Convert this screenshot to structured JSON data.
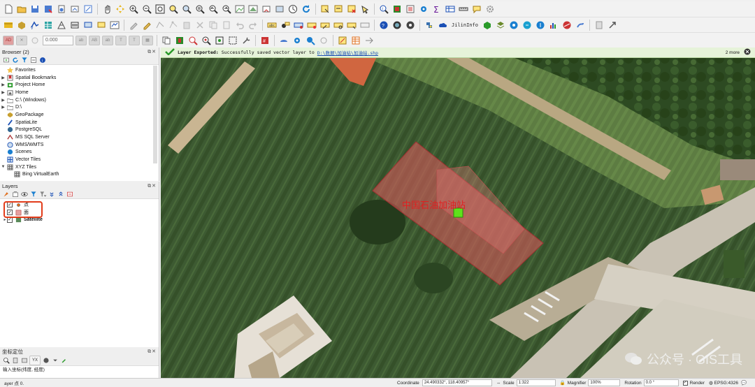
{
  "browser_panel": {
    "title": "Browser (2)",
    "items": [
      {
        "label": "Favorites",
        "icon": "star-icon",
        "expandable": false
      },
      {
        "label": "Spatial Bookmarks",
        "icon": "bookmark-icon",
        "expandable": true
      },
      {
        "label": "Project Home",
        "icon": "project-home-icon",
        "expandable": true
      },
      {
        "label": "Home",
        "icon": "home-folder-icon",
        "expandable": true
      },
      {
        "label": "C:\\ (Windows)",
        "icon": "drive-icon",
        "expandable": true
      },
      {
        "label": "D:\\",
        "icon": "drive-icon",
        "expandable": true
      },
      {
        "label": "GeoPackage",
        "icon": "geopackage-icon",
        "expandable": false
      },
      {
        "label": "SpatiaLite",
        "icon": "spatialite-icon",
        "expandable": false
      },
      {
        "label": "PostgreSQL",
        "icon": "postgresql-icon",
        "expandable": false
      },
      {
        "label": "MS SQL Server",
        "icon": "mssql-icon",
        "expandable": false
      },
      {
        "label": "WMS/WMTS",
        "icon": "wms-icon",
        "expandable": false
      },
      {
        "label": "Scenes",
        "icon": "scenes-icon",
        "expandable": false
      },
      {
        "label": "Vector Tiles",
        "icon": "vector-tiles-icon",
        "expandable": false
      },
      {
        "label": "XYZ Tiles",
        "icon": "xyz-tiles-icon",
        "expandable": true
      },
      {
        "label": "Bing VirtualEarth",
        "icon": "xyz-tile-layer-icon",
        "expandable": false
      }
    ]
  },
  "layers_panel": {
    "title": "Layers",
    "layers": [
      {
        "label": "点",
        "checked": true,
        "icon": "point-symbol-icon"
      },
      {
        "label": "面",
        "checked": true,
        "icon": "polygon-symbol-icon"
      },
      {
        "label": "Satellite",
        "checked": true,
        "icon": "raster-icon"
      }
    ]
  },
  "coord_panel": {
    "title": "坐标定位",
    "input_placeholder": "输入坐标(纬度, 经度)",
    "yx_label": "YX"
  },
  "message_bar": {
    "title": "Layer Exported:",
    "text": "Successfully saved vector layer to",
    "link": "D:\\数据\\加油站\\加油站.shp",
    "count": "2 more"
  },
  "map": {
    "feature_label": "中国石油加油站",
    "colors": {
      "polygon_fill": "#d25a5a",
      "point_fill": "#5fe21b",
      "label": "#e02020"
    }
  },
  "toolbar": {
    "buffer_value": "0.000",
    "plugin_label": "JilinInfo"
  },
  "status_bar": {
    "left_hint": "ayer 点 0.",
    "coordinate_label": "Coordinate",
    "coordinate_value": "24.490332°, 118.40957°",
    "scale_label": "Scale",
    "scale_value": "1:322",
    "magnifier_label": "Magnifier",
    "magnifier_value": "100%",
    "rotation_label": "Rotation",
    "rotation_value": "0.0 °",
    "render_label": "Render",
    "crs_label": "EPSG:4326"
  },
  "watermark": {
    "text": "公众号 · GIS工具"
  }
}
